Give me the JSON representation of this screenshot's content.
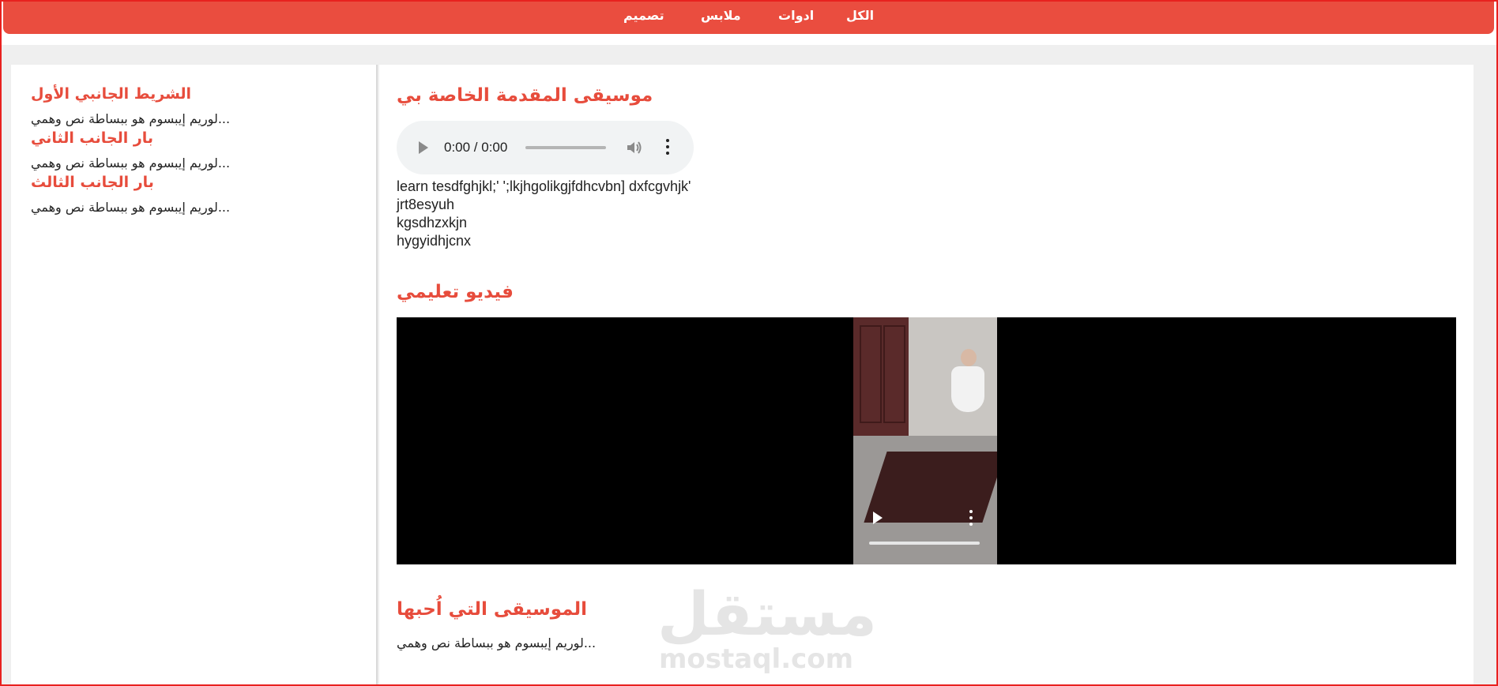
{
  "nav": {
    "items": [
      {
        "label": "الكل"
      },
      {
        "label": "ادوات"
      },
      {
        "label": "ملابس"
      },
      {
        "label": "تصميم"
      }
    ]
  },
  "sidebar": {
    "sections": [
      {
        "title": "الشريط الجانبي الأول",
        "text": "لوريم إيبسوم هو ببساطة نص وهمي..."
      },
      {
        "title": "بار الجانب الثاني",
        "text": "لوريم إيبسوم هو ببساطة نص وهمي..."
      },
      {
        "title": "بار الجانب الثالث",
        "text": "لوريم إيبسوم هو ببساطة نص وهمي..."
      }
    ]
  },
  "main": {
    "music_title": "موسيقى المقدمة الخاصة بي",
    "audio_time": "0:00 / 0:00",
    "lines": [
      "learn tesdfghjkl;' ';lkjhgolikgjfdhcvbn] dxfcgvhjk'",
      "jrt8esyuh",
      "kgsdhzxkjn",
      "hygyidhjcnx"
    ],
    "video_title": "فيديو تعليمي",
    "fav_title": "الموسيقى التي اُحبها",
    "fav_text": "لوريم إيبسوم هو ببساطة نص وهمي..."
  },
  "watermark": {
    "arabic": "مستقل",
    "latin": "mostaql.com"
  },
  "colors": {
    "accent": "#ea4d3f",
    "heading": "#e74c3c"
  },
  "icons": [
    "play-icon",
    "volume-icon",
    "more-options-icon"
  ]
}
